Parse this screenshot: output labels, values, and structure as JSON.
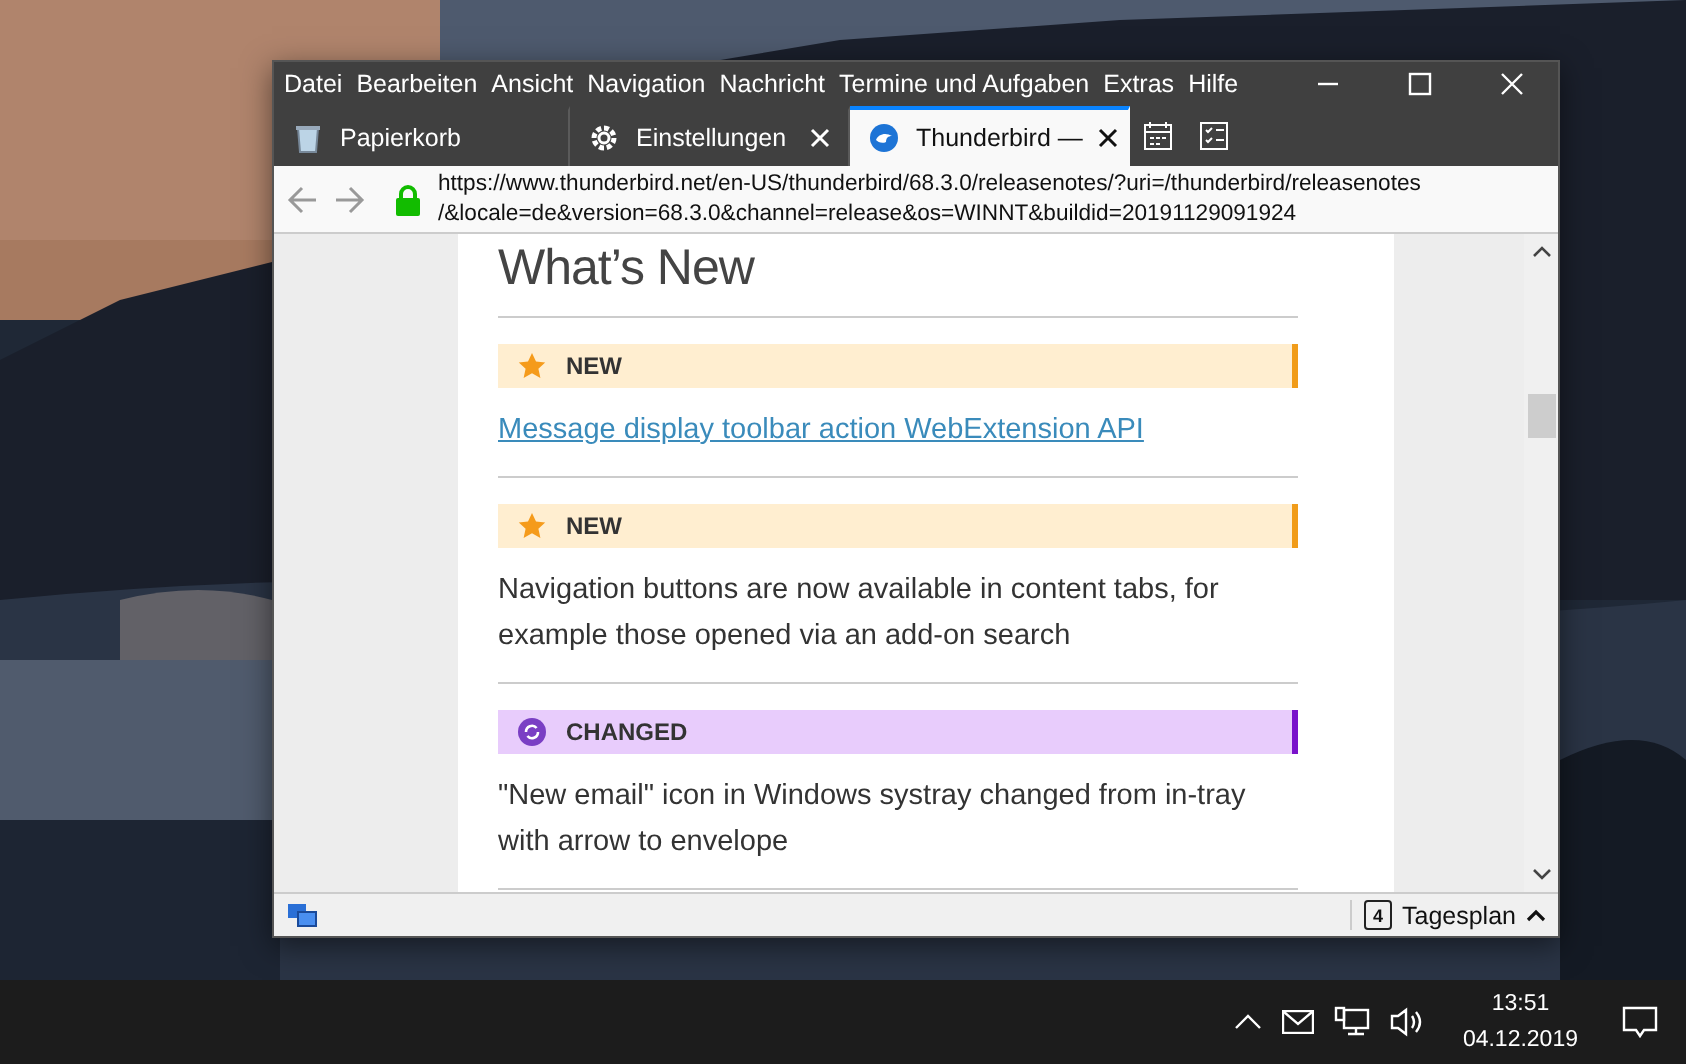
{
  "menu": [
    "Datei",
    "Bearbeiten",
    "Ansicht",
    "Navigation",
    "Nachricht",
    "Termine und Aufgaben",
    "Extras",
    "Hilfe"
  ],
  "tabs": [
    {
      "label": "Papierkorb",
      "kind": "trash",
      "selected": false,
      "closable": false
    },
    {
      "label": "Einstellungen",
      "kind": "settings",
      "selected": false,
      "closable": true
    },
    {
      "label": "Thunderbird —",
      "kind": "browser",
      "selected": true,
      "closable": true
    }
  ],
  "url": [
    "https://www.thunderbird.net/en-US/thunderbird/68.3.0/releasenotes/?uri=/thunderbird/releasenotes",
    "/&locale=de&version=68.3.0&channel=release&os=WINNT&buildid=20191129091924"
  ],
  "page": {
    "heading": "What’s New",
    "entries": [
      {
        "kind": "new",
        "tag": "NEW",
        "text": "Message display toolbar action WebExtension API",
        "link": true
      },
      {
        "kind": "new",
        "tag": "NEW",
        "text": "Navigation buttons are now available in content tabs, for example those opened via an add-on search",
        "link": false
      },
      {
        "kind": "changed",
        "tag": "CHANGED",
        "text": "\"New email\" icon in Windows systray changed from in-tray with arrow to envelope",
        "link": false
      }
    ]
  },
  "status_bar": {
    "day": "4",
    "label": "Tagesplan"
  },
  "taskbar": {
    "time": "13:51",
    "date": "04.12.2019"
  }
}
